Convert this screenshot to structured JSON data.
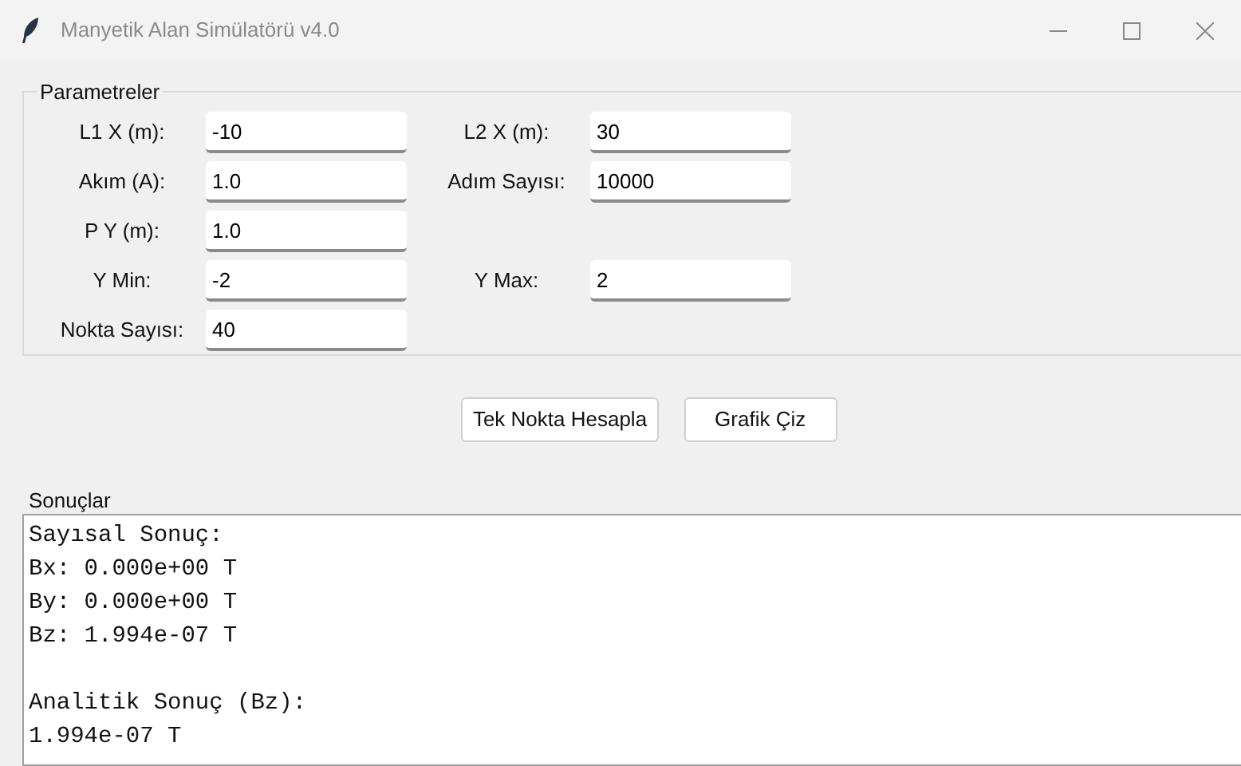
{
  "window": {
    "title": "Manyetik Alan Simülatörü v4.0"
  },
  "parameters": {
    "title": "Parametreler",
    "rows": [
      [
        {
          "label": "L1 X (m):",
          "value": "-10"
        },
        {
          "label": "L2 X (m):",
          "value": "30"
        }
      ],
      [
        {
          "label": "Akım (A):",
          "value": "1.0"
        },
        {
          "label": "Adım Sayısı:",
          "value": "10000"
        }
      ],
      [
        {
          "label": "P Y (m):",
          "value": "1.0"
        }
      ],
      [
        {
          "label": "Y Min:",
          "value": "-2"
        },
        {
          "label": "Y Max:",
          "value": "2"
        }
      ],
      [
        {
          "label": "Nokta Sayısı:",
          "value": "40"
        }
      ]
    ]
  },
  "buttons": [
    "Tek Nokta Hesapla",
    "Grafik Çiz"
  ],
  "results": {
    "title": "Sonuçlar",
    "blocks": [
      [
        "Sayısal Sonuç:",
        "Bx: 0.000e+00 T",
        "By: 0.000e+00 T",
        "Bz: 1.994e-07 T"
      ],
      [
        "Analitik Sonuç (Bz):",
        "1.994e-07 T"
      ]
    ]
  }
}
